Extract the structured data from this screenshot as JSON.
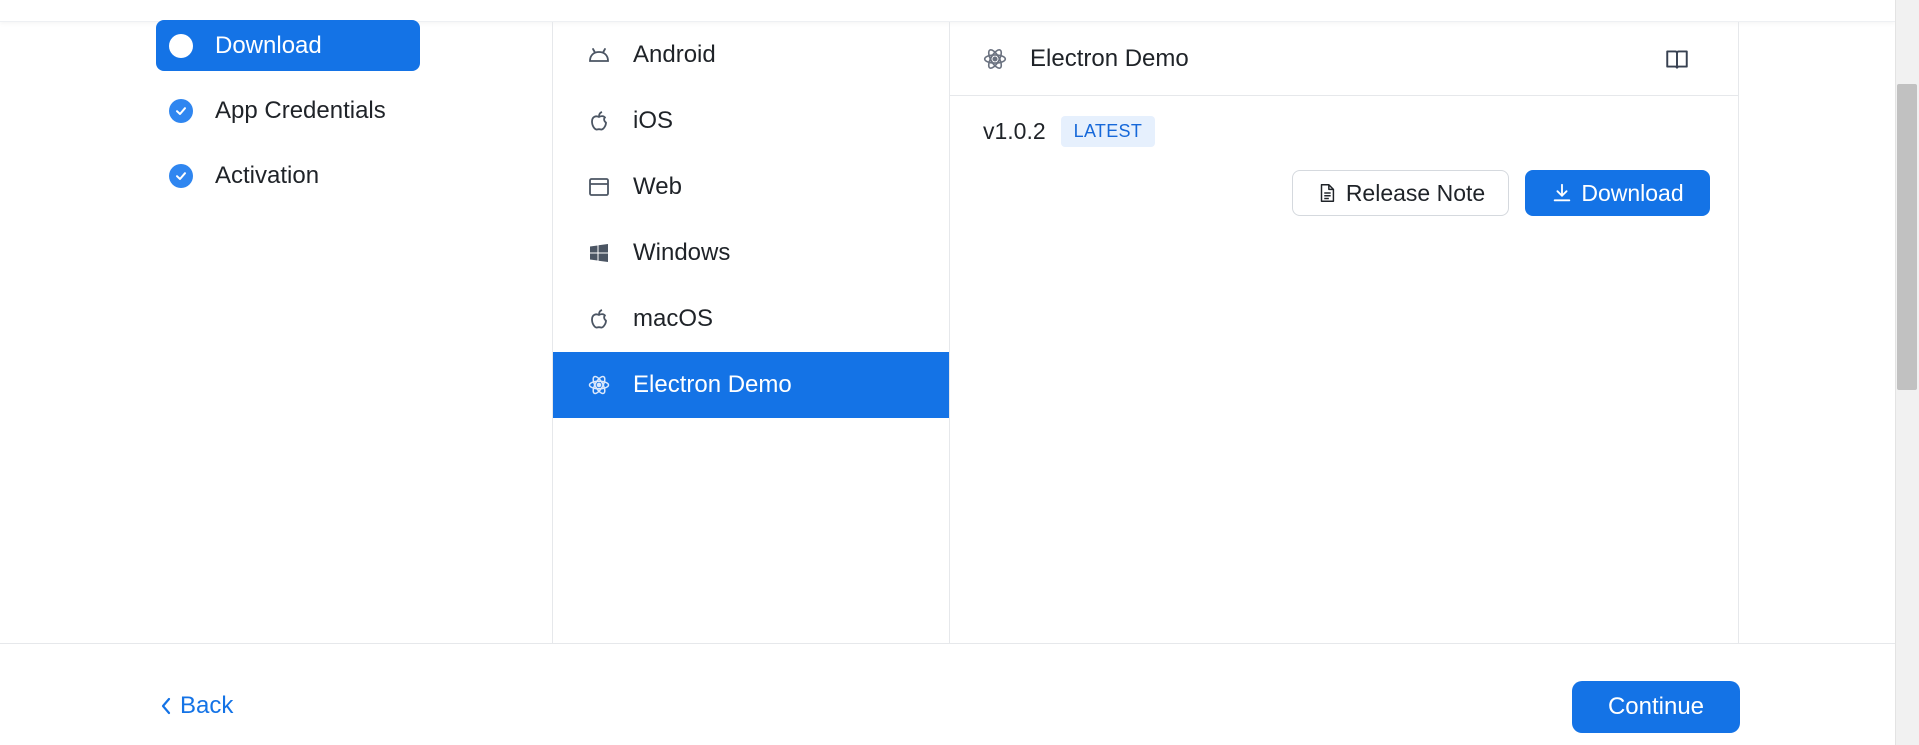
{
  "steps": [
    {
      "label": "Download",
      "state": "active"
    },
    {
      "label": "App Credentials",
      "state": "done"
    },
    {
      "label": "Activation",
      "state": "done"
    }
  ],
  "platforms": [
    {
      "label": "Android",
      "icon": "android-icon"
    },
    {
      "label": "iOS",
      "icon": "apple-icon"
    },
    {
      "label": "Web",
      "icon": "browser-window-icon"
    },
    {
      "label": "Windows",
      "icon": "windows-icon"
    },
    {
      "label": "macOS",
      "icon": "apple-icon"
    },
    {
      "label": "Electron Demo",
      "icon": "electron-icon",
      "selected": true
    }
  ],
  "detail": {
    "title": "Electron Demo",
    "icon": "electron-icon",
    "version": "v1.0.2",
    "badge": "LATEST",
    "release_note_label": "Release Note",
    "download_label": "Download"
  },
  "footer": {
    "back_label": "Back",
    "continue_label": "Continue"
  },
  "colors": {
    "accent": "#1473e6",
    "badge_bg": "#e6f0fd",
    "check": "#2f86f0"
  }
}
